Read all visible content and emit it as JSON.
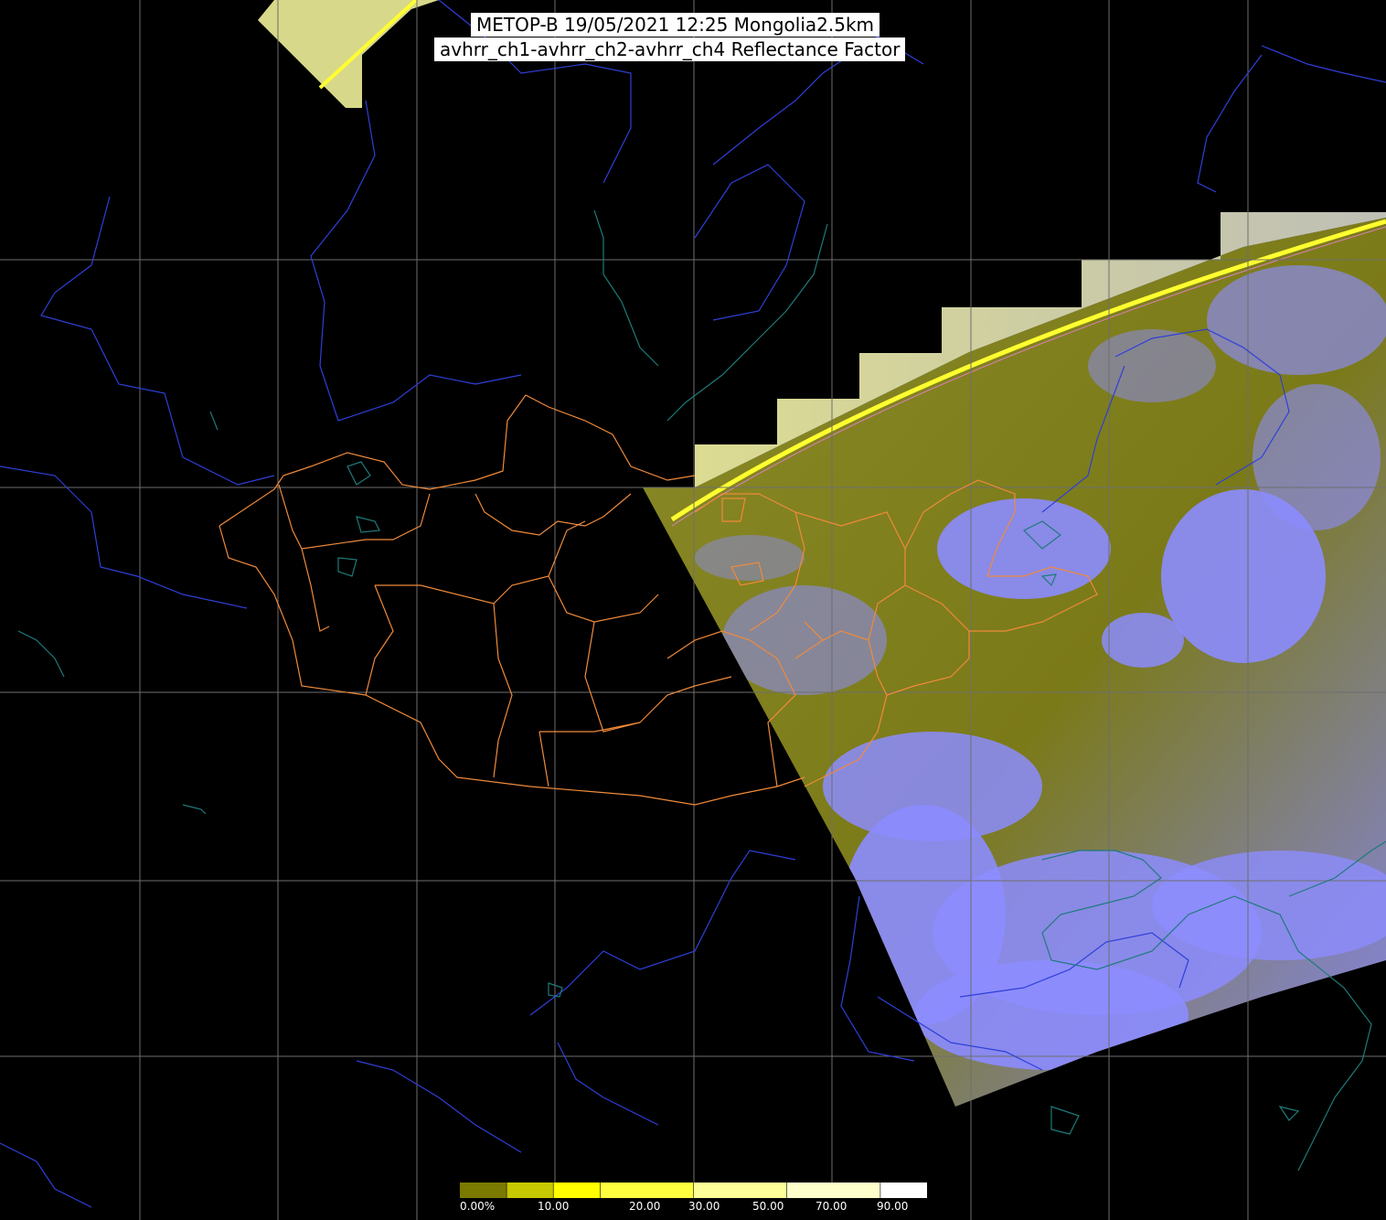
{
  "title": {
    "line1": "METOP-B 19/05/2021 12:25 Mongolia2.5km",
    "line2": "avhrr_ch1-avhrr_ch2-avhrr_ch4 Reflectance Factor"
  },
  "colorbar": {
    "labels": [
      "0.00%",
      "10.00",
      "20.00",
      "30.00",
      "50.00",
      "70.00",
      "90.00"
    ],
    "min": 0,
    "max": 100,
    "stops": [
      {
        "value": 0,
        "color": "#7a7a00"
      },
      {
        "value": 10,
        "color": "#c8c800"
      },
      {
        "value": 20,
        "color": "#ffff00"
      },
      {
        "value": 30,
        "color": "#ffff40"
      },
      {
        "value": 50,
        "color": "#ffff99"
      },
      {
        "value": 70,
        "color": "#ffffcc"
      },
      {
        "value": 90,
        "color": "#ffffff"
      }
    ]
  },
  "colors": {
    "background": "#000000",
    "grid": "#6e6e6e",
    "rivers": "#2f3fd8",
    "coastline": "#1f7a7a",
    "provinces": "#f08a3a",
    "surface": "#7b7a18",
    "cloud": "#8c8cff"
  }
}
